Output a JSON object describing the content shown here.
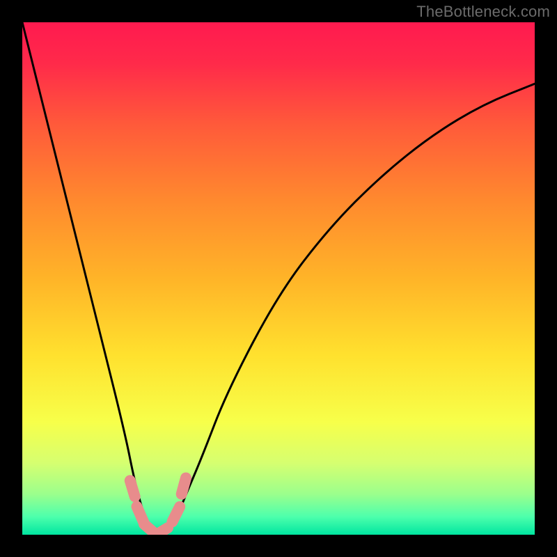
{
  "watermark": "TheBottleneck.com",
  "chart_data": {
    "type": "line",
    "title": "",
    "xlabel": "",
    "ylabel": "",
    "xlim": [
      0,
      100
    ],
    "ylim": [
      0,
      100
    ],
    "grid": false,
    "legend": false,
    "annotations": [],
    "series": [
      {
        "name": "bottleneck-curve",
        "x": [
          0,
          5,
          10,
          15,
          20,
          22,
          24,
          26,
          28,
          30,
          32,
          35,
          40,
          50,
          60,
          70,
          80,
          90,
          100
        ],
        "y": [
          100,
          80,
          60,
          40,
          20,
          10,
          3,
          0,
          0,
          3,
          8,
          15,
          28,
          47,
          60,
          70,
          78,
          84,
          88
        ]
      }
    ],
    "highlight_points": {
      "name": "near-zero-markers",
      "x": [
        21.5,
        23.0,
        25.0,
        27.0,
        30.0,
        31.5
      ],
      "y": [
        9.0,
        4.0,
        1.0,
        0.5,
        4.0,
        9.5
      ]
    },
    "background_gradient": {
      "stops": [
        {
          "offset": 0.0,
          "color": "#ff1a4f"
        },
        {
          "offset": 0.08,
          "color": "#ff2a4a"
        },
        {
          "offset": 0.2,
          "color": "#ff5a3a"
        },
        {
          "offset": 0.35,
          "color": "#ff8a2e"
        },
        {
          "offset": 0.5,
          "color": "#ffb428"
        },
        {
          "offset": 0.65,
          "color": "#ffe12e"
        },
        {
          "offset": 0.78,
          "color": "#f7ff4a"
        },
        {
          "offset": 0.86,
          "color": "#d6ff70"
        },
        {
          "offset": 0.92,
          "color": "#9cff8c"
        },
        {
          "offset": 0.965,
          "color": "#4dffac"
        },
        {
          "offset": 1.0,
          "color": "#00e6a0"
        }
      ]
    },
    "curve_color": "#000000",
    "marker_color": "#e88c8c"
  }
}
